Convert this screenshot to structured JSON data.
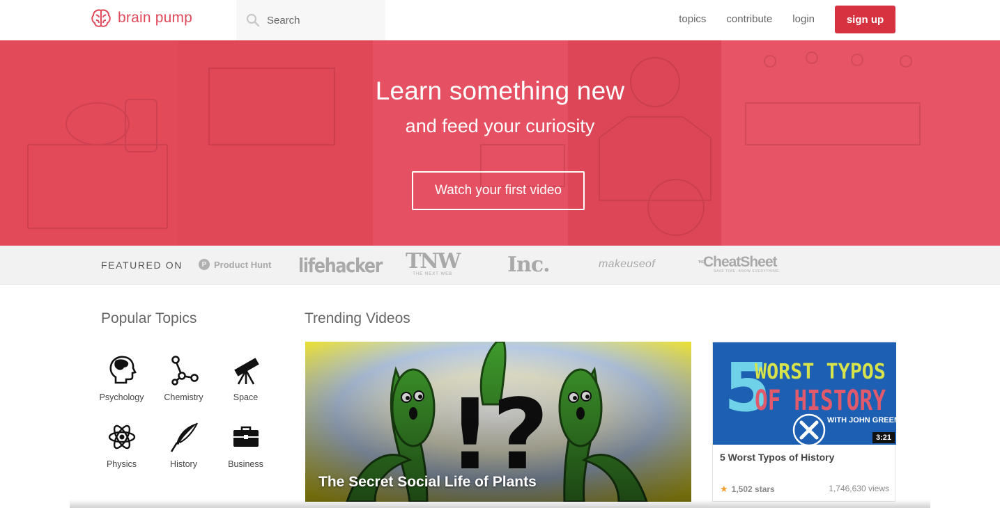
{
  "header": {
    "brand": "brain pump",
    "search_placeholder": "Search",
    "nav": [
      "topics",
      "contribute",
      "login"
    ],
    "signup_label": "sign up",
    "brand_color": "#e04a5b",
    "signup_color": "#d6323f"
  },
  "hero": {
    "headline": "Learn something new",
    "subheadline": "and feed your curiosity",
    "cta_label": "Watch your first video",
    "background_color": "#e84f60"
  },
  "featured": {
    "label": "FEATURED ON",
    "outlets": [
      {
        "name": "Product Hunt",
        "badge": "P"
      },
      {
        "name": "lifehacker"
      },
      {
        "name": "TNW",
        "tagline": "THE NEXT WEB"
      },
      {
        "name": "Inc."
      },
      {
        "name": "makeuseof"
      },
      {
        "name": "CheatSheet",
        "prefix": "THE",
        "tagline": "SAVE TIME. KNOW EVERYTHING."
      }
    ]
  },
  "popular_topics": {
    "title": "Popular Topics",
    "items": [
      {
        "label": "Psychology",
        "icon": "head-icon"
      },
      {
        "label": "Chemistry",
        "icon": "molecule-icon"
      },
      {
        "label": "Space",
        "icon": "telescope-icon"
      },
      {
        "label": "Physics",
        "icon": "atom-icon"
      },
      {
        "label": "History",
        "icon": "quill-icon"
      },
      {
        "label": "Business",
        "icon": "briefcase-icon"
      }
    ]
  },
  "trending": {
    "title": "Trending Videos",
    "videos": [
      {
        "title": "The Secret Social Life of Plants",
        "thumb_text": "!?"
      },
      {
        "title": "5 Worst Typos of History",
        "thumb_lines": [
          "5",
          "WORST TYPOS",
          "OF HISTORY",
          "WITH JOHN GREEN"
        ],
        "duration": "3:21",
        "stars": "1,502 stars",
        "views": "1,746,630 views"
      }
    ]
  }
}
